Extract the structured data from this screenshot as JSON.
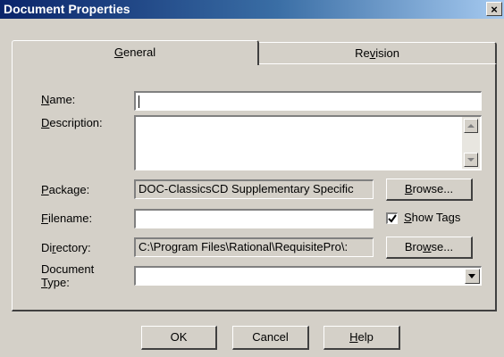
{
  "window": {
    "title": "Document Properties",
    "close_glyph": "×"
  },
  "tabs": {
    "general": {
      "pre": "",
      "key": "G",
      "post": "eneral"
    },
    "revision": {
      "pre": "Re",
      "key": "v",
      "post": "ision"
    }
  },
  "fields": {
    "name": {
      "label_pre": "",
      "label_key": "N",
      "label_post": "ame:",
      "value": ""
    },
    "description": {
      "label_pre": "",
      "label_key": "D",
      "label_post": "escription:",
      "value": ""
    },
    "package": {
      "label_pre": "",
      "label_key": "P",
      "label_post": "ackage:",
      "value": "DOC-ClassicsCD Supplementary Specific"
    },
    "filename": {
      "label_pre": "",
      "label_key": "F",
      "label_post": "ilename:",
      "value": ""
    },
    "directory": {
      "label_pre": "Di",
      "label_key": "r",
      "label_post": "ectory:",
      "value": "C:\\Program Files\\Rational\\RequisitePro\\:"
    },
    "doc_type": {
      "label_line1": "Document",
      "label_key": "T",
      "label_post": "ype:",
      "value": ""
    }
  },
  "buttons": {
    "browse_package": {
      "pre": "",
      "key": "B",
      "post": "rowse..."
    },
    "browse_directory": {
      "pre": "Bro",
      "key": "w",
      "post": "se..."
    },
    "ok": {
      "pre": "",
      "key": "",
      "post": "OK"
    },
    "cancel": {
      "pre": "",
      "key": "",
      "post": "Cancel"
    },
    "help": {
      "pre": "",
      "key": "H",
      "post": "elp"
    }
  },
  "show_tags": {
    "pre": "",
    "key": "S",
    "post": "how Tags",
    "checked": true,
    "check_glyph": "✔"
  }
}
